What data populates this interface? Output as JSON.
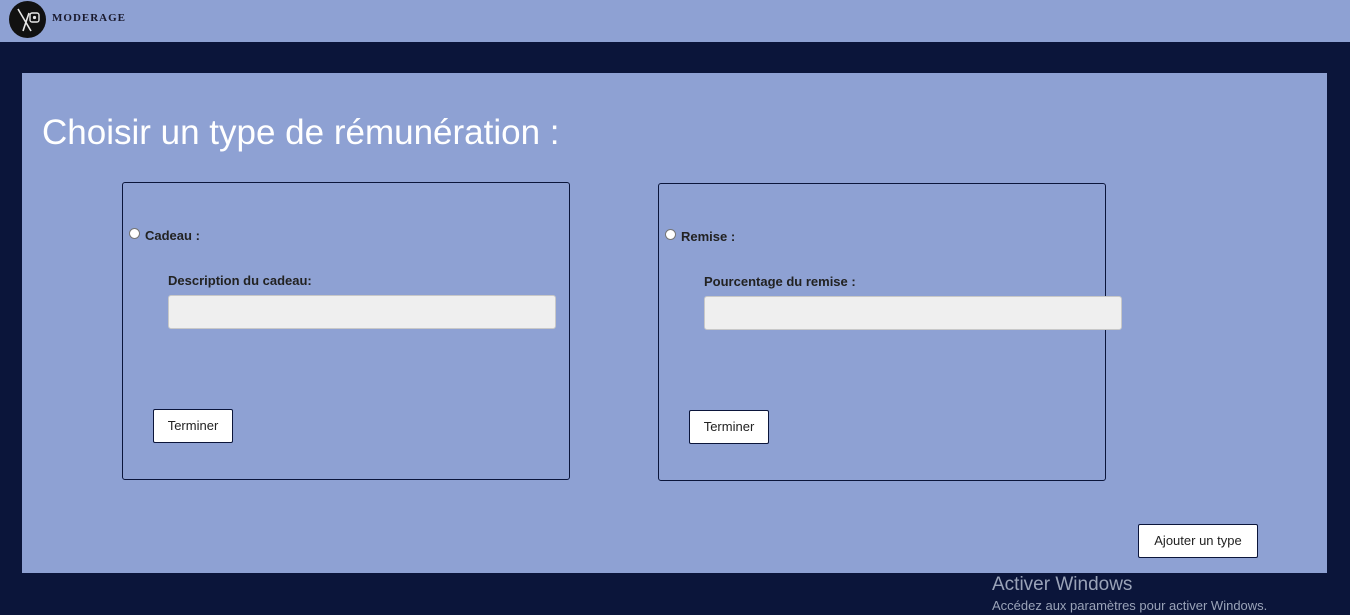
{
  "header": {
    "brand": "MODERAGE",
    "logo_icon": "moderage-logo-icon"
  },
  "main": {
    "title": "Choisir un type de rémunération :",
    "options": [
      {
        "radio_label": "Cadeau :",
        "field_label": "Description du cadeau:",
        "input_value": "",
        "button_label": "Terminer",
        "selected": false
      },
      {
        "radio_label": "Remise :",
        "field_label": "Pourcentage du remise :",
        "input_value": "",
        "button_label": "Terminer",
        "selected": false
      }
    ],
    "add_button_label": "Ajouter un type"
  },
  "watermark": {
    "title": "Activer Windows",
    "subtitle": "Accédez aux paramètres pour activer Windows."
  },
  "colors": {
    "background": "#0b153a",
    "panel": "#8ea1d3",
    "input": "#efefef"
  }
}
